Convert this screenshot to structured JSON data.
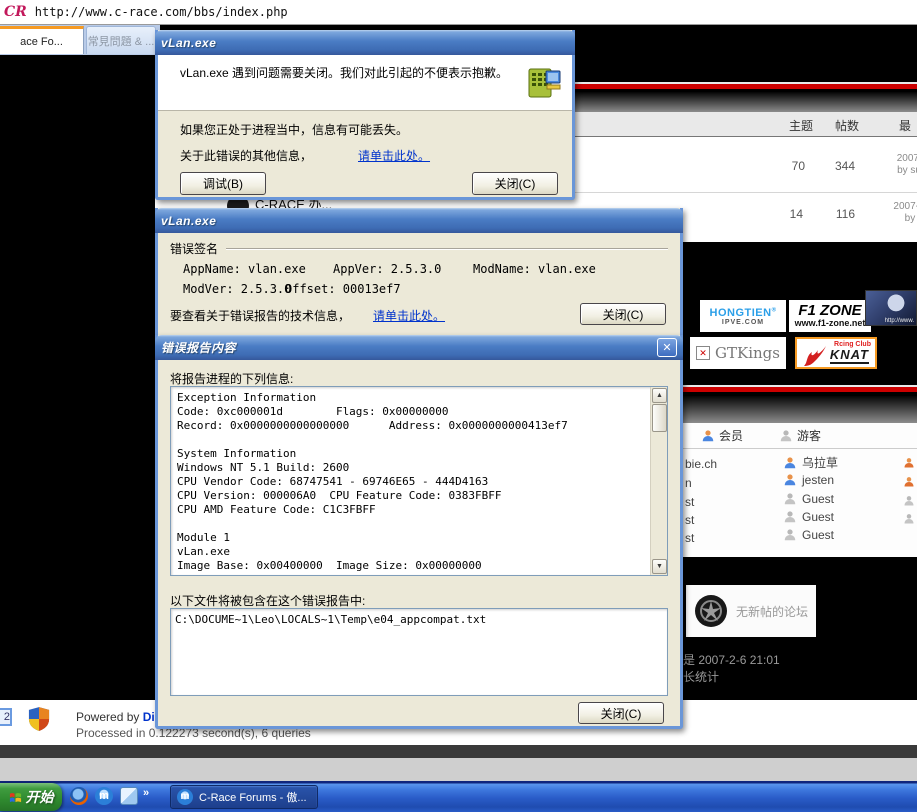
{
  "colors": {
    "accent_red": "#cc0000",
    "link_blue": "#0033cc",
    "taskbar_blue": "#2a5cc8",
    "start_green": "#2f8a2f",
    "title_blue": "#4a7cc4"
  },
  "browser": {
    "logo": "CR",
    "url": "http://www.c-race.com/bbs/index.php",
    "tab1": "ace Fo...",
    "tab2": "常見問題 & ..."
  },
  "forum": {
    "table": {
      "header_topics": "主题",
      "header_posts": "帖数",
      "header_last": "最",
      "row1": {
        "topics": "70",
        "posts": "344",
        "last1": "2007",
        "last2": "by su"
      },
      "row2": {
        "topics": "14",
        "posts": "116",
        "last1": "2007-",
        "last2": "by s",
        "name_fragment": "C-RACE 办..."
      }
    },
    "banners": {
      "hongtien_line1": "HONGTIEN",
      "hongtien_line2": "IPVE.COM",
      "f1zone_line1": "F1 ZONE",
      "f1zone_line2": "www.f1-zone.net",
      "anime_caption": "http://www.",
      "gtkings": "GTKings",
      "knat_club": "Rcing Club",
      "knat_name": "KNAT"
    },
    "legend": {
      "member": "会员",
      "guest": "游客"
    },
    "online": {
      "col_a": [
        "bie.ch",
        "n",
        "st",
        "st",
        "st"
      ],
      "col_b": [
        {
          "name": "乌拉草",
          "type": "member"
        },
        {
          "name": "jesten",
          "type": "member"
        },
        {
          "name": "Guest",
          "type": "guest"
        },
        {
          "name": "Guest",
          "type": "guest"
        },
        {
          "name": "Guest",
          "type": "guest"
        }
      ]
    },
    "no_new_posts": "无新帖的论坛",
    "time_fragment": "是 2007-2-6 21:01",
    "stats_fragment": "长统计",
    "footer": {
      "powered_prefix": "Powered by ",
      "powered_link": "Discu",
      "processed": "Processed in 0.122273 second(s), 6 queries",
      "page_badge": "2"
    }
  },
  "dialog1": {
    "title": "vLan.exe",
    "message": "vLan.exe 遇到问题需要关闭。我们对此引起的不便表示抱歉。",
    "info": "如果您正处于进程当中，信息有可能丢失。",
    "more_prefix": "关于此错误的其他信息，",
    "more_link": "请单击此处。",
    "debug_button": "调试(B)",
    "close_button": "关闭(C)"
  },
  "dialog2": {
    "title": "vLan.exe",
    "group_label": "错误签名",
    "appname": "AppName: vlan.exe",
    "appver": "AppVer: 2.5.3.0",
    "modname": "ModName: vlan.exe",
    "modver": "ModVer: 2.5.3.0",
    "offset": "Offset: 00013ef7",
    "tech_prefix": "要查看关于错误报告的技术信息，",
    "tech_link": "请单击此处。",
    "close_button": "关闭(C)"
  },
  "dialog3": {
    "title": "错误报告内容",
    "close_x": "✕",
    "report_label": "将报告进程的下列信息:",
    "report_text": "Exception Information\nCode: 0xc000001d        Flags: 0x00000000\nRecord: 0x0000000000000000      Address: 0x0000000000413ef7\n\nSystem Information\nWindows NT 5.1 Build: 2600\nCPU Vendor Code: 68747541 - 69746E65 - 444D4163\nCPU Version: 000006A0  CPU Feature Code: 0383FBFF\nCPU AMD Feature Code: C1C3FBFF\n\nModule 1\nvLan.exe\nImage Base: 0x00400000  Image Size: 0x00000000",
    "files_label": "以下文件将被包含在这个错误报告中:",
    "file_path": "C:\\DOCUME~1\\Leo\\LOCALS~1\\Temp\\e04_appcompat.txt",
    "close_button": "关闭(C)",
    "scroll_up": "▲",
    "scroll_down": "▼"
  },
  "taskbar": {
    "start": "开始",
    "quick_launch_more": "»",
    "maxthon_m": "m",
    "task_button": "C-Race Forums - 傲..."
  }
}
